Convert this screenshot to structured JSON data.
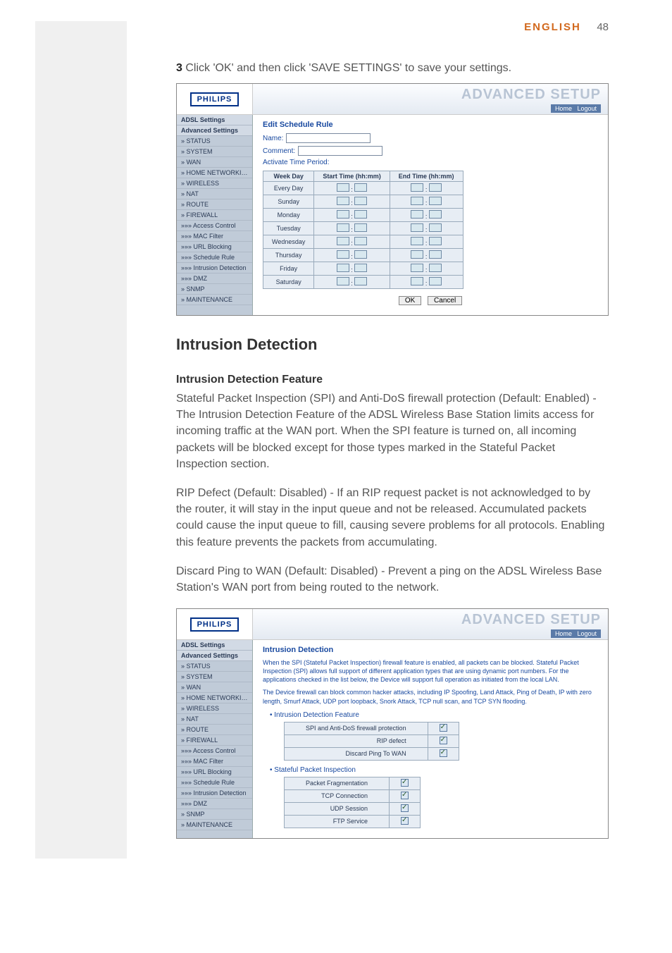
{
  "header": {
    "lang": "ENGLISH",
    "page_num": "48"
  },
  "step": {
    "num": "3",
    "text": " Click 'OK' and then click 'SAVE SETTINGS' to save your settings."
  },
  "ss_common": {
    "logo": "PHILIPS",
    "banner_title": "ADVANCED SETUP",
    "home_link": "Home",
    "logout_link": "Logout"
  },
  "sidebar1": [
    "ADSL Settings",
    "Advanced Settings",
    "» STATUS",
    "» SYSTEM",
    "» WAN",
    "» HOME NETWORKING",
    "» WIRELESS",
    "» NAT",
    "» ROUTE",
    "» FIREWALL",
    "»»» Access Control",
    "»»» MAC Filter",
    "»»» URL Blocking",
    "»»» Schedule Rule",
    "»»» Intrusion Detection",
    "»»» DMZ",
    "» SNMP",
    "» MAINTENANCE"
  ],
  "ss1": {
    "title": "Edit Schedule Rule",
    "name_label": "Name:",
    "comment_label": "Comment:",
    "activate_label": "Activate Time Period:",
    "cols": {
      "day": "Week Day",
      "start": "Start Time (hh:mm)",
      "end": "End Time (hh:mm)"
    },
    "days": [
      "Every Day",
      "Sunday",
      "Monday",
      "Tuesday",
      "Wednesday",
      "Thursday",
      "Friday",
      "Saturday"
    ],
    "ok": "OK",
    "cancel": "Cancel"
  },
  "section_title": "Intrusion Detection",
  "feature_heading": "Intrusion Detection Feature",
  "para1": "Stateful Packet Inspection (SPI) and Anti-DoS firewall protection (Default: Enabled) - The Intrusion Detection Feature of the ADSL Wireless Base Station limits access for incoming traffic at the WAN port. When the SPI feature is turned on, all incoming packets will be blocked except for those types marked in the Stateful Packet Inspection section.",
  "para2": "RIP Defect (Default: Disabled) - If an RIP request packet is not acknowledged to by the router, it will stay in the input queue and not be released. Accumulated packets could cause the input queue to fill, causing severe problems for all protocols. Enabling this feature prevents the packets from accumulating.",
  "para3": "Discard Ping to WAN (Default: Disabled) - Prevent a ping on the ADSL Wireless Base Station's WAN port from being routed to the network.",
  "sidebar2": [
    "ADSL Settings",
    "Advanced Settings",
    "» STATUS",
    "» SYSTEM",
    "» WAN",
    "» HOME NETWORKING",
    "» WIRELESS",
    "» NAT",
    "» ROUTE",
    "» FIREWALL",
    "»»» Access Control",
    "»»» MAC Filter",
    "»»» URL Blocking",
    "»»» Schedule Rule",
    "»»» Intrusion Detection",
    "»»» DMZ",
    "» SNMP",
    "» MAINTENANCE"
  ],
  "ss2": {
    "title": "Intrusion Detection",
    "desc1": "When the SPI (Stateful Packet Inspection) firewall feature is enabled, all packets can be blocked. Stateful Packet Inspection (SPI) allows full support of different application types that are using dynamic port numbers. For the applications checked in the list below, the Device will support full operation as initiated from the local LAN.",
    "desc2": "The Device firewall can block common hacker attacks, including IP Spoofing, Land Attack, Ping of Death, IP with zero length, Smurf Attack, UDP port loopback, Snork Attack, TCP null scan, and TCP SYN flooding.",
    "bullet1": "Intrusion Detection Feature",
    "rows1": [
      "SPI and Anti-DoS firewall protection",
      "RIP defect",
      "Discard Ping To WAN"
    ],
    "bullet2": "Stateful Packet Inspection",
    "rows2": [
      "Packet Fragmentation",
      "TCP Connection",
      "UDP Session",
      "FTP Service"
    ]
  }
}
